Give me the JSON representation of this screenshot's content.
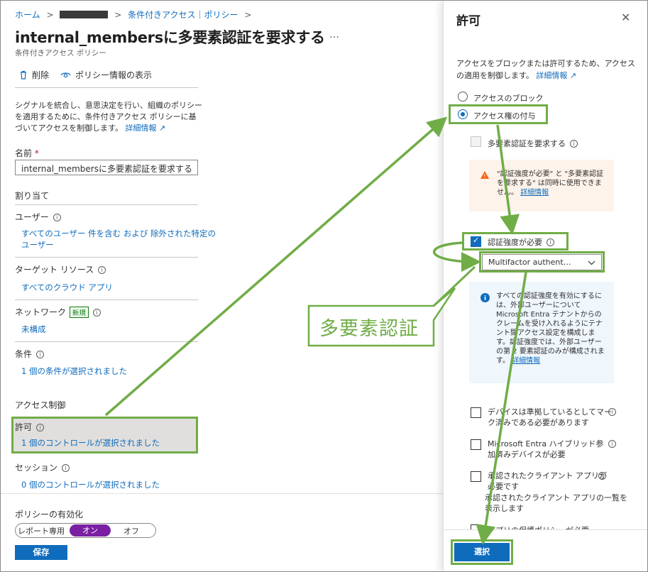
{
  "breadcrumb": {
    "home": "ホーム",
    "conditional_access": "条件付きアクセス｜ポリシー",
    "separator": ">"
  },
  "policy": {
    "title": "internal_membersに多要素認証を要求する",
    "more": "…",
    "subtitle": "条件付きアクセス ポリシー"
  },
  "toolbar": {
    "delete_label": "削除",
    "view_info_label": "ポリシー情報の表示"
  },
  "description": {
    "text": "シグナルを統合し、意思決定を行い、組織のポリシーを適用するために、条件付きアクセス ポリシーに基づいてアクセスを制御します。",
    "learn_more": "詳細情報"
  },
  "name_field": {
    "label": "名前",
    "required_mark": "*",
    "value": "internal_membersに多要素認証を要求する"
  },
  "assignments": {
    "heading": "割り当て",
    "users_label": "ユーザー",
    "users_value_line1": "すべてのユーザー 件を含む および 除外された特定の",
    "users_value_line2": "ユーザー",
    "target_label": "ターゲット リソース",
    "target_value": "すべてのクラウド アプリ",
    "network_label": "ネットワーク",
    "network_badge": "新規",
    "network_value": "未構成",
    "conditions_label": "条件",
    "conditions_value": "1 個の条件が選択されました"
  },
  "access_controls": {
    "heading": "アクセス制御",
    "grant_label": "許可",
    "grant_value": "1 個のコントロールが選択されました",
    "session_label": "セッション",
    "session_value": "0 個のコントロールが選択されました"
  },
  "enable_policy": {
    "label": "ポリシーの有効化",
    "options": [
      "レポート専用",
      "オン",
      "オフ"
    ],
    "selected": "オン"
  },
  "save_label": "保存",
  "grant_panel": {
    "title": "許可",
    "close": "✕",
    "description": "アクセスをブロックまたは許可するため、アクセスの適用を制御します。",
    "learn_more": "詳細情報",
    "block_label": "アクセスのブロック",
    "grant_access_label": "アクセス権の付与",
    "require_mfa_label": "多要素認証を要求する",
    "warning_text": "\"認証強度が必要\" と \"多要素認証を要求する\" は同時に使用できません。",
    "warning_link": "詳細情報",
    "require_auth_strength_label": "認証強度が必要",
    "auth_strength_value": "Multifactor authent…",
    "info_text": "すべての認証強度を有効にするには、外部ユーザーについて Microsoft Entra テナントからのクレームを受け入れるようにテナント間アクセス設定を構成します。認証強度では、外部ユーザーの第 2 要素認証のみが構成されます。",
    "info_link": "詳細情報",
    "compliant_device_label_line1": "デバイスは準拠しているとしてマー",
    "compliant_device_label_line2": "ク済みである必要があります",
    "hybrid_joined_label_line1": "Microsoft Entra ハイブリッド参",
    "hybrid_joined_label_line2": "加済みデバイスが必要",
    "approved_app_label_line1": "承認されたクライアント アプリが",
    "approved_app_label_line2": "必要です",
    "approved_app_link_line1": "承認されたクライアント アプリの一覧を",
    "approved_app_link_line2": "表示します",
    "app_protection_label": "アプリの保護ポリシーが必要",
    "select_button": "選択"
  },
  "annotation": {
    "callout_text": "多要素認証",
    "color": "#70ad47"
  },
  "colors": {
    "link": "#0f6cbd",
    "toggle_on": "#7a1fa2",
    "annotation_green": "#70ad47",
    "warning_bg": "#fdf3ea",
    "info_bg": "#eff6fc"
  }
}
